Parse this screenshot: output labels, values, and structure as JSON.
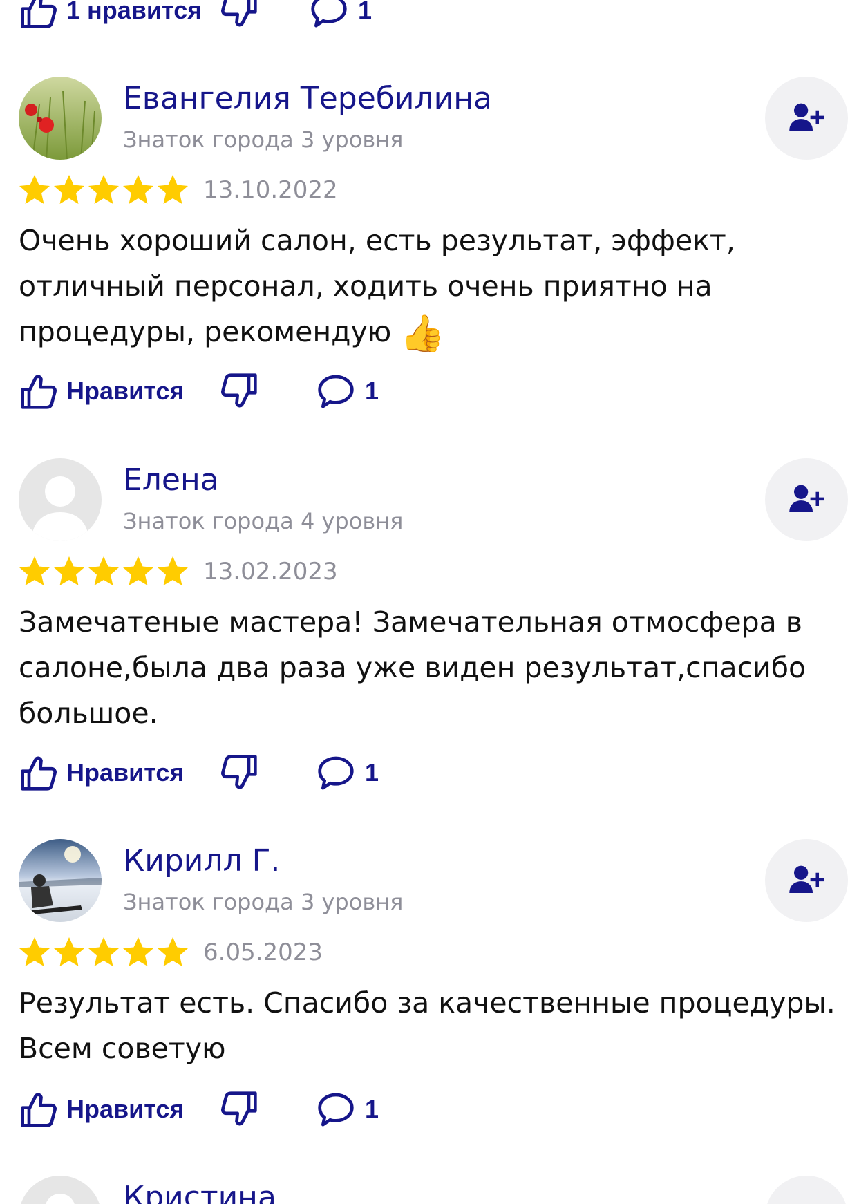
{
  "top_actions": {
    "like_label": "1 нравится",
    "comments_count": "1"
  },
  "reviews": [
    {
      "author": "Евангелия Теребилина",
      "level": "Знаток города 3 уровня",
      "rating": 5,
      "date": "13.10.2022",
      "text": "Очень хороший салон, есть результат, эффект, отличный персонал, ходить очень приятно на процедуры, рекомендую",
      "emoji": "👍",
      "like_label": "Нравится",
      "comments_count": "1",
      "avatar": "poppy-field-photo"
    },
    {
      "author": "Елена",
      "level": "Знаток города 4 уровня",
      "rating": 5,
      "date": "13.02.2023",
      "text": "Замечатеные мастера! Замечательная отмосфера в салоне,была два раза уже виден результат,спасибо большое.",
      "like_label": "Нравится",
      "comments_count": "1",
      "avatar": "default-silhouette"
    },
    {
      "author": "Кирилл Г.",
      "level": "Знаток города 3 уровня",
      "rating": 5,
      "date": "6.05.2023",
      "text": "Результат есть. Спасибо за качественные процедуры. Всем советую",
      "like_label": "Нравится",
      "comments_count": "1",
      "avatar": "snowboarder-photo"
    },
    {
      "author": "Кристина",
      "avatar": "default-silhouette"
    }
  ],
  "colors": {
    "accent": "#16168a",
    "star": "#ffcc00",
    "muted": "#8e8e98",
    "button_bg": "#f1f1f3"
  },
  "icons": [
    "thumb-up-icon",
    "thumb-down-icon",
    "comment-icon",
    "add-user-icon",
    "star-icon"
  ]
}
